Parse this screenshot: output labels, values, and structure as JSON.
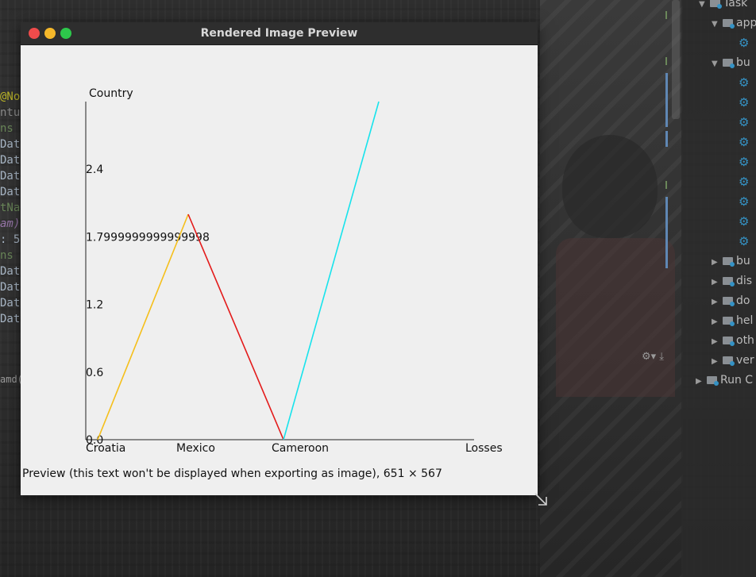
{
  "window": {
    "title": "Rendered Image Preview",
    "status": "Preview (this text won't be displayed when exporting as image), 651 × 567"
  },
  "chart_data": {
    "type": "line",
    "ylabel": "Country",
    "xlabel": "Losses",
    "categories": [
      "Croatia",
      "Mexico",
      "Cameroon"
    ],
    "y_ticks": [
      "0.0",
      "0.6",
      "1.2",
      "1.7999999999999998",
      "2.4"
    ],
    "ylim": [
      0,
      3.0
    ],
    "segments": [
      {
        "from_x": "Croatia",
        "to_x": "Mexico",
        "from_y": 0.0,
        "to_y": 2.0,
        "color": "#f5bf1a"
      },
      {
        "from_x": "Mexico",
        "to_x": "Cameroon",
        "from_y": 2.0,
        "to_y": 0.0,
        "color": "#e31a1a"
      },
      {
        "from_x": "Cameroon",
        "to_x": "Losses",
        "from_y": 0.0,
        "to_y": 3.0,
        "color": "#17e3ec"
      }
    ],
    "legend": "none",
    "grid": false
  },
  "code_fragments": [
    "@No",
    "ntu",
    "ns",
    "Dat",
    "Dat",
    "Dat",
    "Dat",
    "tNa",
    "am)",
    ": 5",
    "ns",
    "Dat",
    "Dat",
    "Dat",
    "Dat",
    "amd("
  ],
  "project_tree": [
    {
      "label": "Task",
      "type": "folder-open"
    },
    {
      "label": "app",
      "type": "folder-open"
    },
    {
      "label": "",
      "type": "gear"
    },
    {
      "label": "bu",
      "type": "folder-open"
    },
    {
      "label": "",
      "type": "gear"
    },
    {
      "label": "",
      "type": "gear"
    },
    {
      "label": "",
      "type": "gear"
    },
    {
      "label": "",
      "type": "gear"
    },
    {
      "label": "",
      "type": "gear"
    },
    {
      "label": "",
      "type": "gear"
    },
    {
      "label": "",
      "type": "gear"
    },
    {
      "label": "",
      "type": "gear"
    },
    {
      "label": "",
      "type": "gear"
    },
    {
      "label": "bu",
      "type": "folder-closed"
    },
    {
      "label": "dis",
      "type": "folder-closed"
    },
    {
      "label": "do",
      "type": "folder-closed"
    },
    {
      "label": "hel",
      "type": "folder-closed"
    },
    {
      "label": "oth",
      "type": "folder-closed"
    },
    {
      "label": "ver",
      "type": "folder-closed"
    },
    {
      "label": "Run C",
      "type": "folder-run"
    }
  ],
  "colors": {
    "close": "#ef4b4b",
    "minimize": "#f5b82a",
    "maximize": "#2dc84b",
    "accent": "#3592c4"
  }
}
